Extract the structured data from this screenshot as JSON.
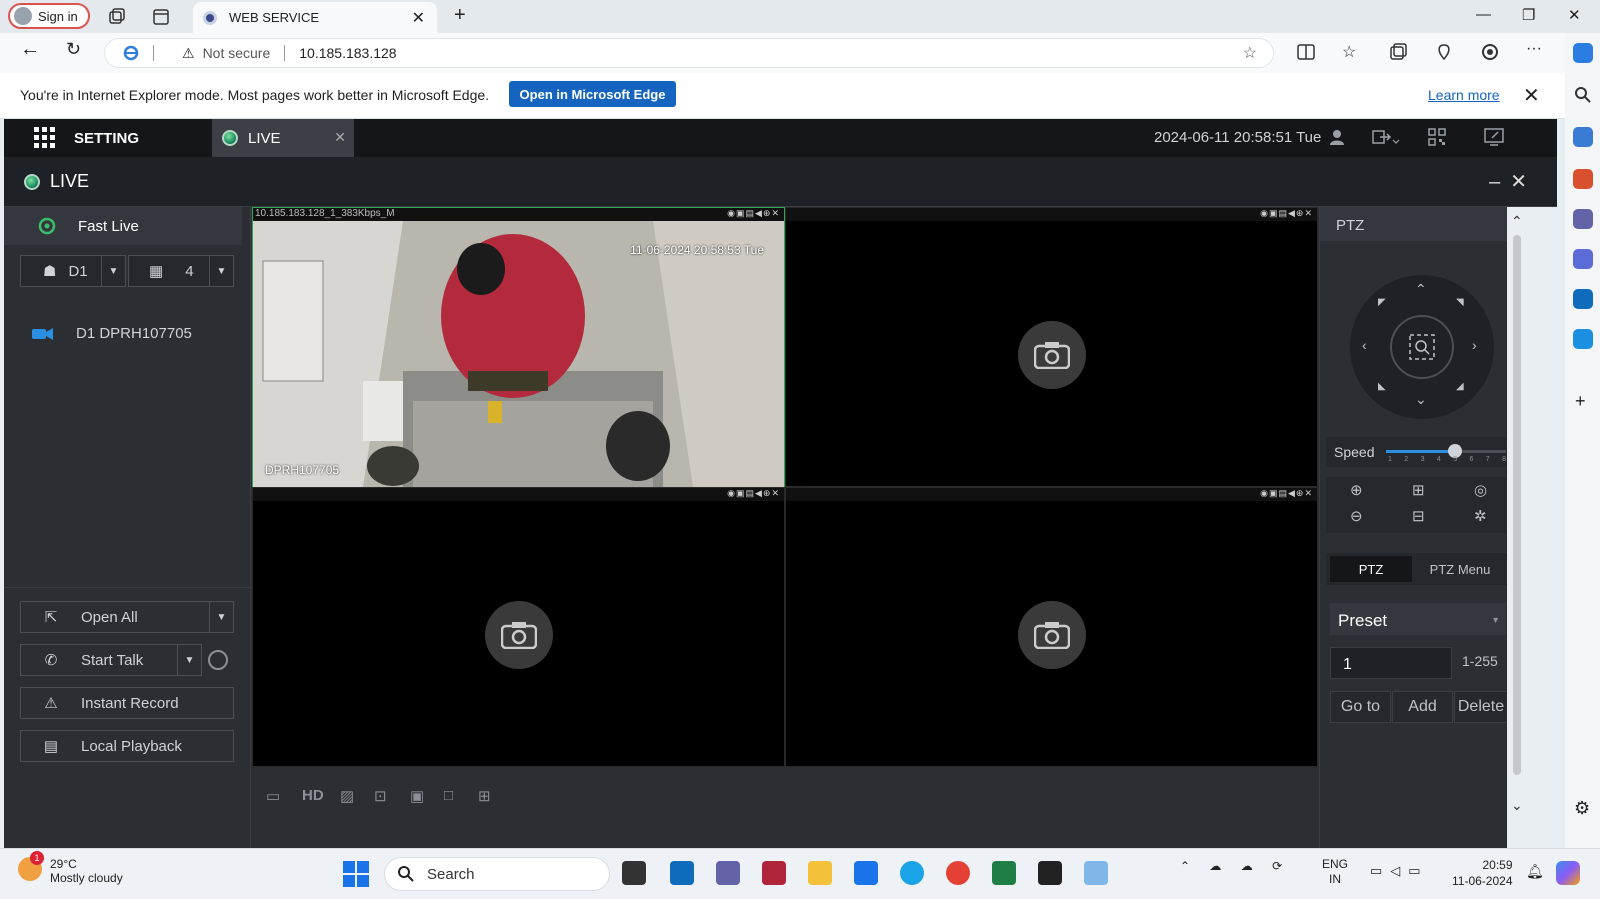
{
  "browser": {
    "signin_label": "Sign in",
    "tab_title": "WEB SERVICE",
    "address_not_secure": "Not secure",
    "address_url": "10.185.183.128",
    "ie_mode_message": "You're in Internet Explorer mode. Most pages work better in Microsoft Edge.",
    "ie_open_button": "Open in Microsoft Edge",
    "ie_learn_more": "Learn more"
  },
  "app": {
    "menu_label": "SETTING",
    "tab_label": "LIVE",
    "datetime": "2024-06-11 20:58:51 Tue",
    "view_title": "LIVE",
    "left": {
      "fast_live": "Fast Live",
      "device_select": "D1",
      "layout_select": "4",
      "device_item": "D1 DPRH107705",
      "open_all": "Open All",
      "start_talk": "Start Talk",
      "instant_record": "Instant Record",
      "local_playback": "Local Playback"
    },
    "video": {
      "channel1_title": "10.185.183.128_1_383Kbps_M",
      "channel1_timestamp": "11-06-2024 20:58:53 Tue",
      "channel1_osd_name": "DPRH107705",
      "toolbar_hd": "HD"
    },
    "ptz": {
      "header": "PTZ",
      "speed_label": "Speed",
      "speed_ticks": [
        "1",
        "2",
        "3",
        "4",
        "5",
        "6",
        "7",
        "8"
      ],
      "speed_value": 5,
      "tab_ptz": "PTZ",
      "tab_menu": "PTZ Menu",
      "preset_label": "Preset",
      "preset_value": "1",
      "preset_range": "1-255",
      "goto_label": "Go to",
      "add_label": "Add",
      "delete_label": "Delete"
    }
  },
  "taskbar": {
    "weather_badge": "1",
    "temperature": "29°C",
    "weather_desc": "Mostly cloudy",
    "search_label": "Search",
    "lang_line1": "ENG",
    "lang_line2": "IN",
    "time": "20:59",
    "date": "11-06-2024"
  },
  "colors": {
    "accent_blue": "#1565c0",
    "live_green": "#2fa84f",
    "app_bg": "#2b2e33"
  }
}
